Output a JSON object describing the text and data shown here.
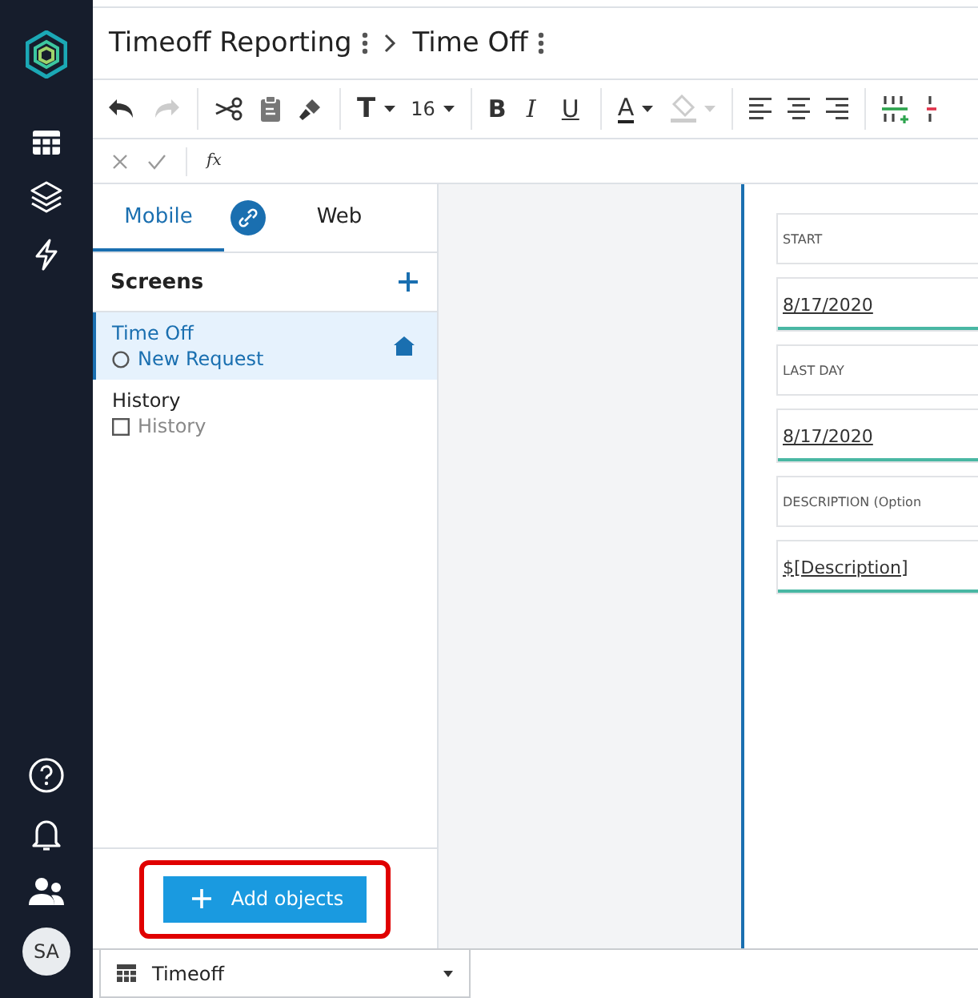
{
  "app_title": "Timeoff Reporting",
  "breadcrumb_page": "Time Off",
  "toolbar": {
    "redo_disabled": true,
    "text_style": "T",
    "font_size": "16",
    "bold": "B",
    "italic": "I",
    "underline": "U",
    "font_color": "A",
    "fill_disabled": true
  },
  "formula_bar": {
    "fx": "fx"
  },
  "tabs": [
    {
      "label": "Mobile",
      "selected": true
    },
    {
      "label": "Web",
      "selected": false
    }
  ],
  "screens": {
    "title": "Screens",
    "items": [
      {
        "name": "Time Off",
        "selected": true,
        "home": true,
        "sub": {
          "kind": "form",
          "label": "New Request"
        }
      },
      {
        "name": "History",
        "selected": false,
        "home": false,
        "sub": {
          "kind": "list",
          "label": "History"
        }
      }
    ]
  },
  "add_button": {
    "label": "Add objects",
    "highlighted": true
  },
  "bottom_tab": {
    "label": "Timeoff"
  },
  "avatar": "SA",
  "canvas_fields": [
    {
      "kind": "label",
      "text": "START"
    },
    {
      "kind": "value",
      "text": "8/17/2020"
    },
    {
      "kind": "label",
      "text": "LAST DAY"
    },
    {
      "kind": "value",
      "text": "8/17/2020"
    },
    {
      "kind": "label",
      "text": "DESCRIPTION (Option"
    },
    {
      "kind": "value",
      "text": "$[Description]"
    }
  ]
}
